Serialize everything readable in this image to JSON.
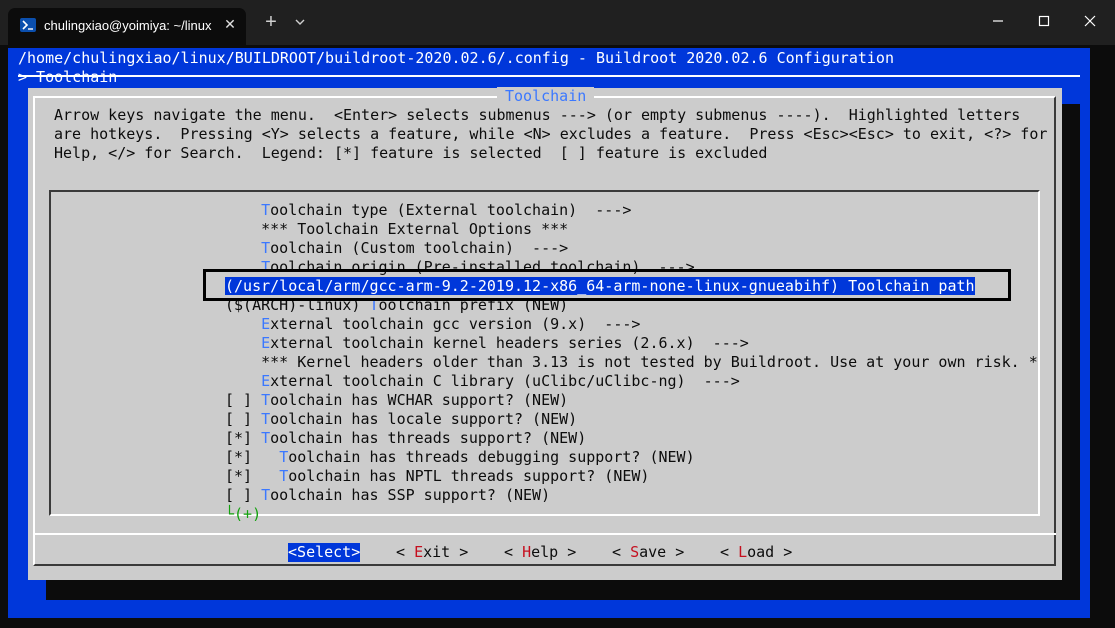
{
  "tab": {
    "title": "chulingxiao@yoimiya: ~/linux",
    "close_icon": "close-icon",
    "new_tab_label": "+",
    "icon": "terminal-icon"
  },
  "window_controls": [
    "minimize-icon",
    "maximize-icon",
    "close-icon"
  ],
  "header": {
    "path_line": "/home/chulingxiao/linux/BUILDROOT/buildroot-2020.02.6/.config - Buildroot 2020.02.6 Configuration",
    "breadcrumb": "> Toolchain"
  },
  "dialog": {
    "title": "Toolchain",
    "help_lines": [
      "Arrow keys navigate the menu.  <Enter> selects submenus ---> (or empty submenus ----).  Highlighted letters",
      "are hotkeys.  Pressing <Y> selects a feature, while <N> excludes a feature.  Press <Esc><Esc> to exit, <?> for",
      "Help, </> for Search.  Legend: [*] feature is selected  [ ] feature is excluded"
    ]
  },
  "menu": {
    "items": [
      {
        "prefix": "    ",
        "hotkey": "T",
        "rest": "oolchain type (External toolchain)  --->"
      },
      {
        "prefix": "    ",
        "hotkey": "",
        "rest": "*** Toolchain External Options ***"
      },
      {
        "prefix": "    ",
        "hotkey": "T",
        "rest": "oolchain (Custom toolchain)  --->"
      },
      {
        "prefix": "    ",
        "hotkey": "T",
        "rest": "oolchain origin (Pre-installed toolchain)  --->"
      },
      {
        "prefix": "",
        "hotkey": "",
        "rest": "(/usr/local/arm/gcc-arm-9.2-2019.12-x86_64-arm-none-linux-gnueabihf) Toolchain path"
      },
      {
        "prefix": "($(ARCH)-linux) ",
        "hotkey": "T",
        "rest": "oolchain prefix (NEW)"
      },
      {
        "prefix": "    ",
        "hotkey": "E",
        "rest": "xternal toolchain gcc version (9.x)  --->"
      },
      {
        "prefix": "    ",
        "hotkey": "E",
        "rest": "xternal toolchain kernel headers series (2.6.x)  --->"
      },
      {
        "prefix": "    ",
        "hotkey": "",
        "rest": "*** Kernel headers older than 3.13 is not tested by Buildroot. Use at your own risk. *"
      },
      {
        "prefix": "    ",
        "hotkey": "E",
        "rest": "xternal toolchain C library (uClibc/uClibc-ng)  --->"
      },
      {
        "prefix": "[ ] ",
        "hotkey": "T",
        "rest": "oolchain has WCHAR support? (NEW)"
      },
      {
        "prefix": "[ ] ",
        "hotkey": "T",
        "rest": "oolchain has locale support? (NEW)"
      },
      {
        "prefix": "[*] ",
        "hotkey": "T",
        "rest": "oolchain has threads support? (NEW)"
      },
      {
        "prefix": "[*]   ",
        "hotkey": "T",
        "rest": "oolchain has threads debugging support? (NEW)"
      },
      {
        "prefix": "[*]   ",
        "hotkey": "T",
        "rest": "oolchain has NPTL threads support? (NEW)"
      },
      {
        "prefix": "[ ] ",
        "hotkey": "T",
        "rest": "oolchain has SSP support? (NEW)"
      }
    ],
    "selected_index": 4,
    "more_indicator": "└(+)"
  },
  "buttons": [
    {
      "pre": "<",
      "hotkey": "S",
      "post": "elect>"
    },
    {
      "pre": "< ",
      "hotkey": "E",
      "post": "xit >"
    },
    {
      "pre": "< ",
      "hotkey": "H",
      "post": "elp >"
    },
    {
      "pre": "< ",
      "hotkey": "S",
      "post": "ave >"
    },
    {
      "pre": "< ",
      "hotkey": "L",
      "post": "oad >"
    }
  ],
  "colors": {
    "background_blue": "#0037da",
    "dialog_gray": "#cccccc",
    "hotkey_blue": "#3b78ff",
    "button_hotkey_red": "#c50f1f",
    "more_green": "#13a10e"
  }
}
